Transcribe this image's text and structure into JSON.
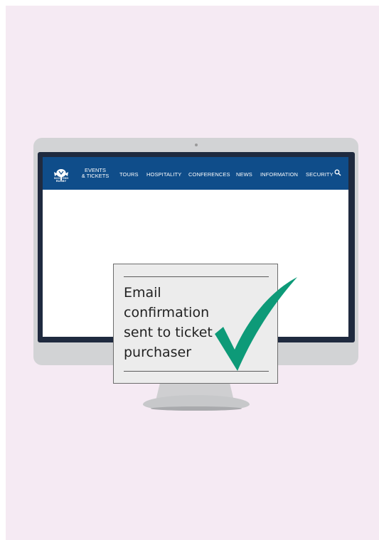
{
  "nav": {
    "logo_text": [
      "SCOTTISH",
      "RUGBY"
    ],
    "events_line1": "EVENTS",
    "events_line2": "& TICKETS",
    "items": [
      "TOURS",
      "HOSPITALITY",
      "CONFERENCES",
      "NEWS",
      "INFORMATION",
      "SECURITY"
    ]
  },
  "card": {
    "message": "Email confirmation sent to ticket purchaser"
  },
  "colors": {
    "page_bg": "#f5eaf3",
    "nav_bg": "#0f4d8a",
    "check": "#0d9a78"
  },
  "icons": [
    "thistle-logo-icon",
    "search-icon",
    "checkmark-icon"
  ]
}
